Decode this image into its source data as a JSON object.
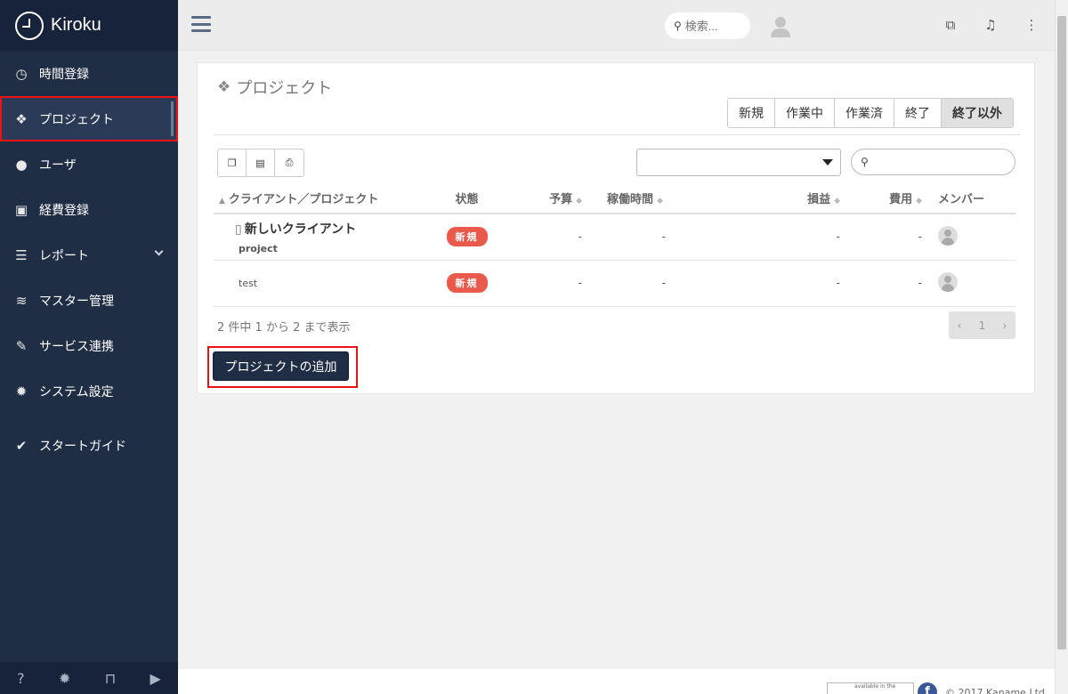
{
  "app": {
    "name": "Kiroku"
  },
  "sidebar": {
    "items": [
      {
        "label": "時間登録",
        "icon": "clock-icon"
      },
      {
        "label": "プロジェクト",
        "icon": "cubes-icon"
      },
      {
        "label": "ユーザ",
        "icon": "user-icon"
      },
      {
        "label": "経費登録",
        "icon": "train-icon"
      },
      {
        "label": "レポート",
        "icon": "list-icon"
      },
      {
        "label": "マスター管理",
        "icon": "database-icon"
      },
      {
        "label": "サービス連携",
        "icon": "plug-icon"
      },
      {
        "label": "システム設定",
        "icon": "gear-icon"
      },
      {
        "label": "スタートガイド",
        "icon": "check-icon"
      }
    ],
    "footer_icons": [
      "help-icon",
      "gear-icon",
      "unlock-icon",
      "play-icon"
    ]
  },
  "header": {
    "search_placeholder": "検索..."
  },
  "page": {
    "title": "プロジェクト",
    "filters": [
      "新規",
      "作業中",
      "作業済",
      "終了",
      "終了以外"
    ],
    "table": {
      "columns": [
        "クライアント／プロジェクト",
        "状態",
        "予算",
        "稼働時間",
        "損益",
        "費用",
        "メンバー"
      ],
      "rows": [
        {
          "client": "新しいクライアント",
          "project": "project",
          "status": "新規",
          "budget": "-",
          "hours": "-",
          "profit": "-",
          "cost": "-"
        },
        {
          "client": "",
          "project": "test",
          "status": "新規",
          "budget": "-",
          "hours": "-",
          "profit": "-",
          "cost": "-"
        }
      ]
    },
    "info": "2 件中 1 から 2 まで表示",
    "pagination": {
      "prev": "‹",
      "current": "1",
      "next": "›"
    },
    "add_button": "プロジェクトの追加"
  },
  "footer": {
    "store_text": "available in the",
    "facebook": "f",
    "copyright": "© 2017 Kaname Ltd"
  },
  "colors": {
    "sidebar": "#1f2d45",
    "badge": "#e95a4c",
    "highlight": "#ee1111"
  }
}
